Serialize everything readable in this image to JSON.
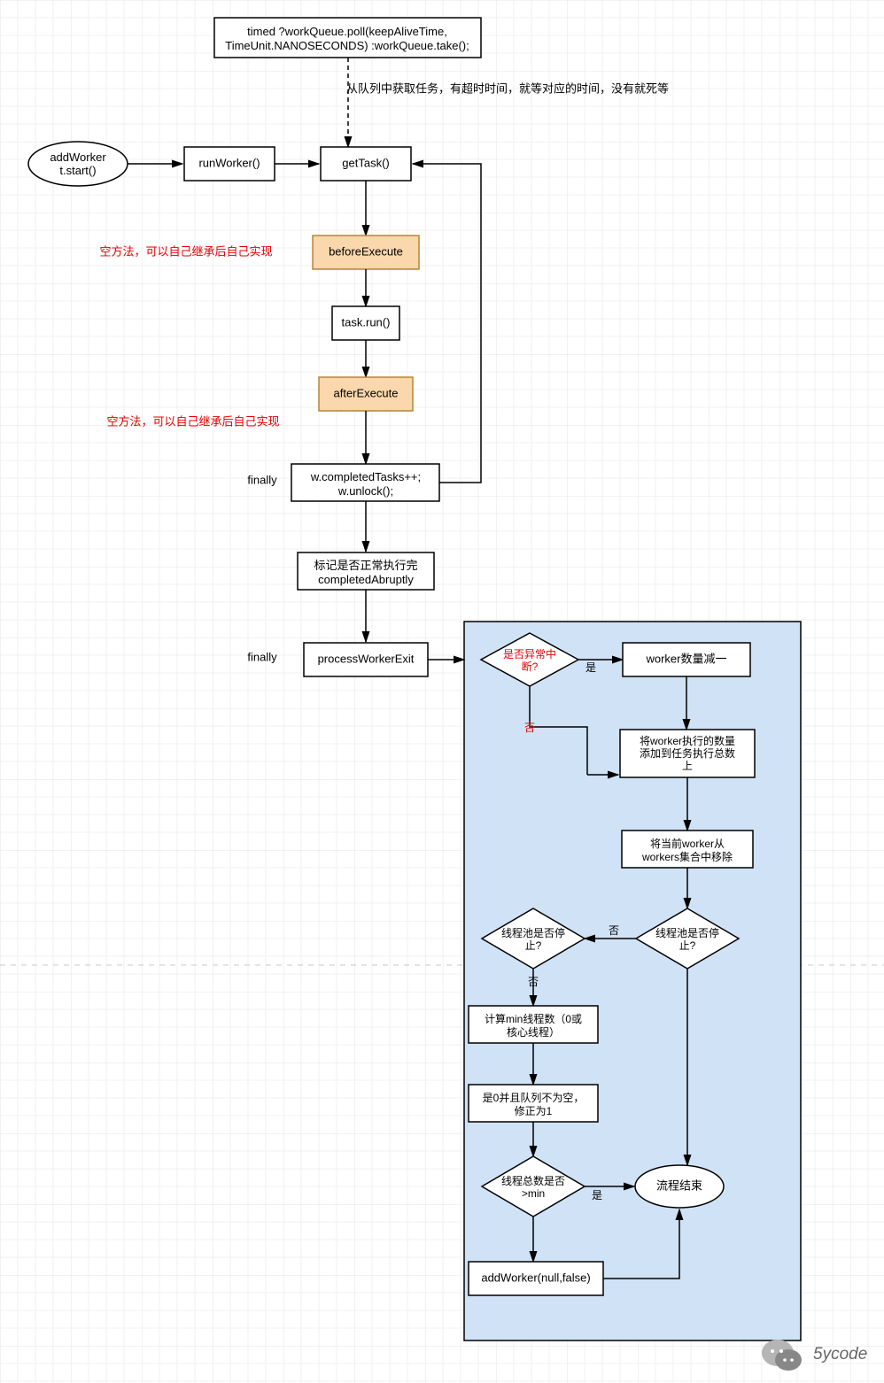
{
  "nodes": {
    "timed": "timed ?workQueue.poll(keepAliveTime,\nTimeUnit.NANOSECONDS) :workQueue.take();",
    "timedNote": "从队列中获取任务，有超时时间，就等对应的时间，没有就死等",
    "addWorker": "addWorker\nt.start()",
    "runWorker": "runWorker()",
    "getTask": "getTask()",
    "beforeExecute": "beforeExecute",
    "beforeNote": "空方法，可以自己继承后自己实现",
    "taskRun": "task.run()",
    "afterExecute": "afterExecute",
    "afterNote": "空方法，可以自己继承后自己实现",
    "completed": "w.completedTasks++;\nw.unlock();",
    "finally1": "finally",
    "abruptly": "标记是否正常执行完\ncompletedAbruptly",
    "finally2": "finally",
    "processExit": "processWorkerExit",
    "d1": "是否异常中\n断?",
    "d1yes": "是",
    "d1no": "否",
    "workerDec": "worker数量减一",
    "addCount": "将worker执行的数量\n添加到任务执行总数\n上",
    "removeWorker": "将当前worker从\nworkers集合中移除",
    "d2": "线程池是否停\n止?",
    "d2no": "否",
    "d3": "线程池是否停\n止?",
    "d3no": "否",
    "calcMin": "计算min线程数（0或\n核心线程）",
    "fix1": "是0并且队列不为空，\n修正为1",
    "d4": "线程总数是否\n>min",
    "d4yes": "是",
    "endFlow": "流程结束",
    "addWorkerNull": "addWorker(null,false)"
  },
  "watermark": "5ycode"
}
